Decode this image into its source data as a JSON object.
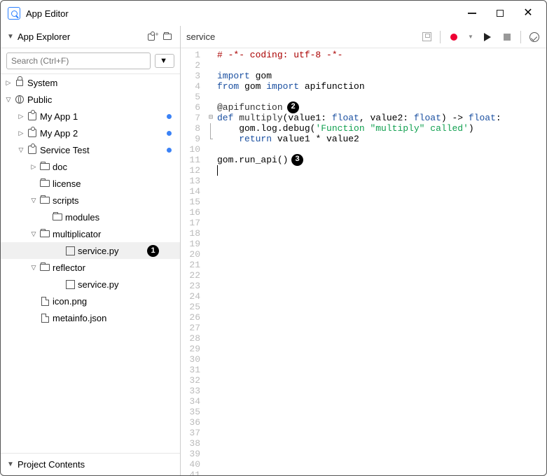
{
  "window": {
    "title": "App Editor"
  },
  "sidebar": {
    "explorer_label": "App Explorer",
    "contents_label": "Project Contents",
    "search_placeholder": "Search (Ctrl+F)",
    "tree": {
      "system": "System",
      "public": "Public",
      "myapp1": "My App 1",
      "myapp2": "My App 2",
      "servicetest": "Service Test",
      "doc": "doc",
      "license": "license",
      "scripts": "scripts",
      "modules": "modules",
      "multiplicator": "multiplicator",
      "servicepy1": "service.py",
      "reflector": "reflector",
      "servicepy2": "service.py",
      "iconpng": "icon.png",
      "metainfo": "metainfo.json"
    }
  },
  "editor": {
    "filename": "service",
    "annotations": {
      "b1": "1",
      "b2": "2",
      "b3": "3"
    },
    "code": {
      "l1_comment": "# -*- coding: utf-8 -*-",
      "l3_import": "import",
      "l3_gom": " gom",
      "l4_from": "from",
      "l4_gom": " gom ",
      "l4_import": "import",
      "l4_api": " apifunction",
      "l6_dec": "@apifunction",
      "l7_def": "def",
      "l7_name": " multiply",
      "l7_p": "(value1: ",
      "l7_t1": "float",
      "l7_c1": ", value2: ",
      "l7_t2": "float",
      "l7_arrow": ") -> ",
      "l7_ret": "float",
      "l7_colon": ":",
      "l8_ind": "    gom.log.debug(",
      "l8_str": "'Function \"multiply\" called'",
      "l8_end": ")",
      "l9_ind": "    ",
      "l9_ret": "return",
      "l9_expr": " value1 * value2",
      "l11": "gom.run_api()"
    }
  }
}
